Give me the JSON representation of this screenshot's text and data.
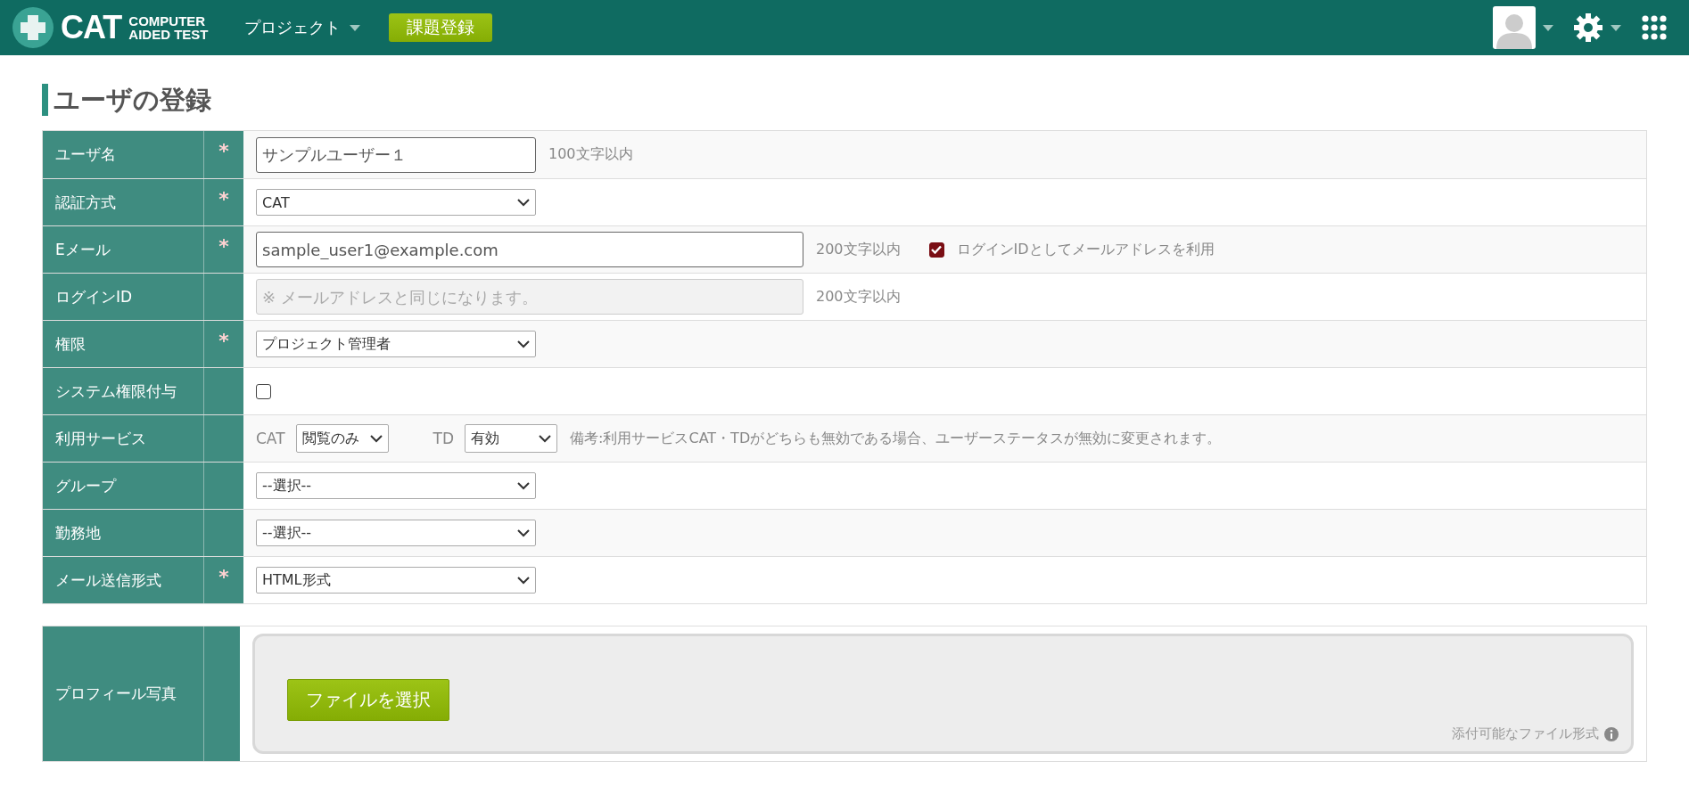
{
  "header": {
    "logo": {
      "mark": "CAT",
      "line1": "COMPUTER",
      "line2": "AIDED TEST"
    },
    "nav": [
      {
        "kind": "menu",
        "label": "プロジェクト"
      },
      {
        "kind": "button",
        "label": "課題登録"
      }
    ]
  },
  "page_title": "ユーザの登録",
  "rows": [
    {
      "label": "ユーザ名",
      "required_mark": "*",
      "items": [
        {
          "kind": "input",
          "value": "サンプルユーザー１"
        },
        {
          "kind": "hint",
          "text": "100文字以内"
        }
      ]
    },
    {
      "label": "認証方式",
      "required_mark": "*",
      "items": [
        {
          "kind": "select",
          "value": "CAT"
        }
      ]
    },
    {
      "label": "Eメール",
      "required_mark": "*",
      "items": [
        {
          "kind": "wide-input",
          "value": "sample_user1@example.com"
        },
        {
          "kind": "hint",
          "text": "200文字以内"
        },
        {
          "kind": "checkbox",
          "checked": true,
          "label": "ログインIDとしてメールアドレスを利用"
        }
      ]
    },
    {
      "label": "ログインID",
      "items": [
        {
          "kind": "wide-input",
          "placeholder": "※ メールアドレスと同じになります。",
          "disabled": true
        },
        {
          "kind": "hint",
          "text": "200文字以内"
        }
      ]
    },
    {
      "label": "権限",
      "required_mark": "*",
      "items": [
        {
          "kind": "select",
          "value": "プロジェクト管理者"
        }
      ]
    },
    {
      "label": "システム権限付与",
      "items": [
        {
          "kind": "checkbox",
          "checked": false
        }
      ]
    },
    {
      "label": "利用サービス",
      "items": [
        {
          "kind": "label",
          "text": "CAT"
        },
        {
          "kind": "small-select",
          "value": "閲覧のみ"
        },
        {
          "kind": "label",
          "text": "TD"
        },
        {
          "kind": "small-select",
          "value": "有効"
        },
        {
          "kind": "hint",
          "text": "備考:利用サービスCAT・TDがどちらも無効である場合、ユーザーステータスが無効に変更されます。"
        }
      ]
    },
    {
      "label": "グループ",
      "items": [
        {
          "kind": "select",
          "value": "--選択--"
        }
      ]
    },
    {
      "label": "勤務地",
      "items": [
        {
          "kind": "select",
          "value": "--選択--"
        }
      ]
    },
    {
      "label": "メール送信形式",
      "required_mark": "*",
      "items": [
        {
          "kind": "select",
          "value": "HTML形式"
        }
      ]
    }
  ],
  "photo": {
    "label": "プロフィール写真",
    "button": "ファイルを選択",
    "formats": "添付可能なファイル形式"
  }
}
